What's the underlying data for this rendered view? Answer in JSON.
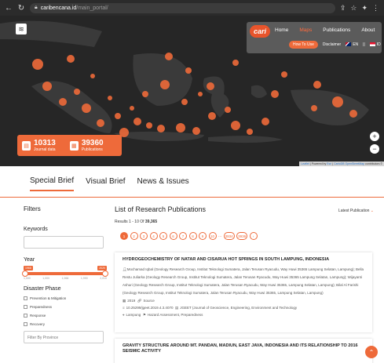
{
  "browser": {
    "host": "caribencana.id",
    "path": "/main_portal/"
  },
  "nav": {
    "logo": "cari",
    "links": [
      "Home",
      "Maps",
      "Publications",
      "About"
    ],
    "active_index": 1,
    "howto": "How To Use",
    "disclaimer": "Disclaimer",
    "lang_en": "EN",
    "lang_sep": "||",
    "lang_id": "ID"
  },
  "stats": {
    "journal_count": "10313",
    "journal_label": "Journal data",
    "pub_count": "39360",
    "pub_label": "Publications"
  },
  "map_attribution": {
    "leaflet": "Leaflet",
    "mid": " | Powered by ",
    "esri": "Esri",
    "carto": "CartoDB",
    "osm": "OpenStreetMap",
    "tail": " contributors © "
  },
  "tabs": [
    "Special Brief",
    "Visual Brief",
    "News & Issues"
  ],
  "filters": {
    "title": "Filters",
    "keywords_label": "Keywords",
    "year_label": "Year",
    "year_min": "1968",
    "year_max": "2020",
    "year_ticks": [
      "1,000",
      "1,000",
      "1,966",
      "1,990",
      "2,010"
    ],
    "phase_label": "Disaster Phase",
    "phases": [
      "Prevention & Mitigation",
      "Preparedness",
      "Response",
      "Recovery"
    ],
    "province_placeholder": "Filter By Province"
  },
  "results": {
    "title": "List of Research Publications",
    "sort_label": "Latest Publication",
    "count_prefix": "Results 1 - 10 Of",
    "count_total": "39,365",
    "pages": [
      "1",
      "2",
      "3",
      "4",
      "5",
      "6",
      "7",
      "8",
      "9",
      "10"
    ],
    "pages_dots": "...",
    "page_last_a": "3934",
    "page_last_b": "3936",
    "page_next": "›",
    "active_page": 0
  },
  "cards": [
    {
      "title": "HYDROGEOCHEMISTRY OF NATAR AND CISARUA HOT SPRINGS IN SOUTH LAMPUNG, INDONESIA",
      "authors": "Mochamad Iqbal (Geology Research Group, Institut Teknologi Sumatera, Jalan Terusan Ryacudu, Way Huwi 35365 Lampung Selatan, Lampung); Bella Restu Juliarka (Geology Research Group, Institut Teknologi Sumatera, Jalan Terusan Ryacudu, Way Huwi 35365 Lampung Selatan, Lampung); Wijayanti Ashuri (Geology Research Group, Institut Teknologi Sumatera, Jalan Terusan Ryacudu, Way Huwi 35365, Lampung Selatan, Lampung); Bilal Al Farishi (Geology Research Group, Institut Teknologi Sumatera, Jalan Terusan Ryacudu, Way Huwi 35365, Lampung Selatan, Lampung)",
      "year": "2019",
      "source": "Source",
      "doi": "10.25299/jgeet.2019.4.3.4070",
      "journal": "JGEET (Journal of Geoscience, Engineering, Environment and Technology",
      "location": "Lampung",
      "tags": "Hazard Assessment, Preparedness"
    },
    {
      "title": "GRAVITY STRUCTURE AROUND MT. PANDAN, MADIUN, EAST JAVA, INDONESIA AND ITS RELATIONSHIP TO 2016 SEISMIC ACTIVITY"
    }
  ],
  "accent_color": "#ee6a3a",
  "icons": {
    "back": "arrow-left-icon",
    "reload": "reload-icon",
    "layers": "layers-icon",
    "journal": "book-icon",
    "publications": "document-icon",
    "zoom_in": "plus-icon",
    "zoom_out": "minus-icon",
    "scroll_top": "chevron-up-icon"
  }
}
